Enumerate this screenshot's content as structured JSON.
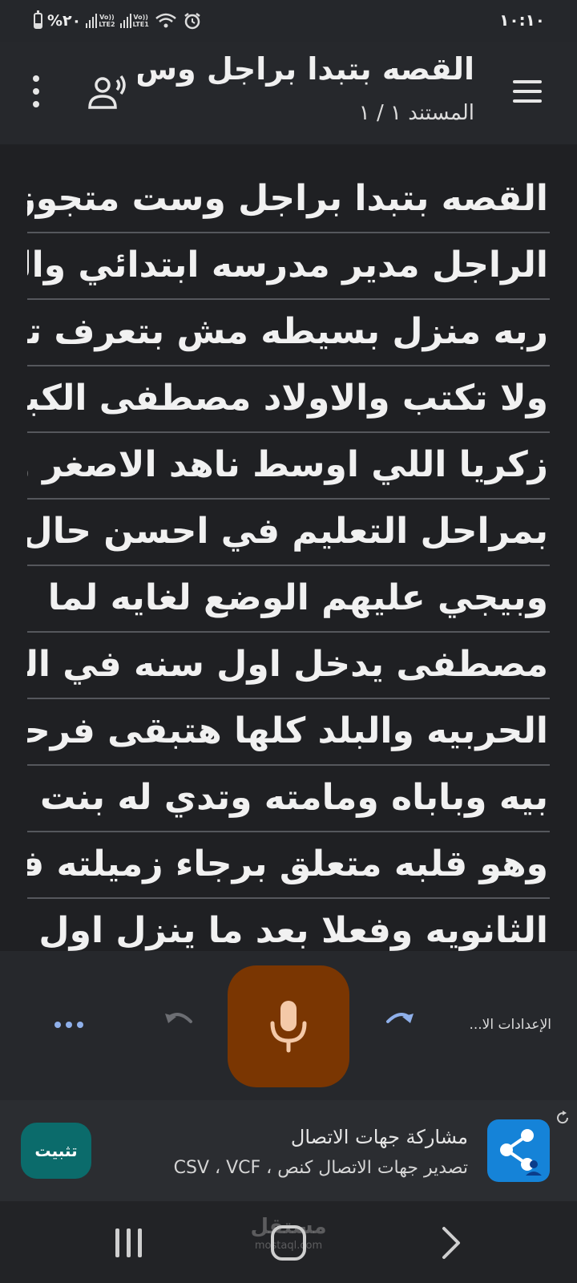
{
  "status_bar": {
    "battery_percent": "%٢٠",
    "sim2_label": "LTE2",
    "sim1_label": "LTE1",
    "volte_label": "Vo))",
    "time": "١٠:١٠"
  },
  "header": {
    "title": "القصه بتبدا براجل وس..",
    "subtitle": "المستند ١ / ١"
  },
  "document": {
    "lines": [
      "القصه بتبدا براجل وست متجوزين",
      "الراجل مدير مدرسه ابتدائي والست",
      "ربه منزل بسيطه مش بتعرف تقرا",
      "ولا تكتب والاولاد مصطفى الكبير",
      "زكريا اللي اوسط ناهد الاصغر وبيمر",
      "بمراحل التعليم في احسن حال",
      "وبيجي عليهم الوضع لغايه لما",
      "مصطفى يدخل اول سنه في الكليه",
      "الحربيه والبلد كلها هتبقى فرحانه",
      "بيه وباباه ومامته وتدي له بنت بناتها",
      "وهو قلبه متعلق برجاء زميلته في",
      "الثانويه وفعلا بعد ما ينزل اول"
    ]
  },
  "controls": {
    "settings_label": "الإعدادات الا...",
    "mic_icon": "mic-icon",
    "accent_color": "#7a3602"
  },
  "ad": {
    "title": "مشاركة جهات الاتصال",
    "subtitle": "تصدير جهات الاتصال كنص ، CSV ، VCF",
    "install_label": "تثبيت"
  },
  "navbar": {
    "watermark": "مستقل",
    "watermark_sub": "mostaql.com"
  }
}
